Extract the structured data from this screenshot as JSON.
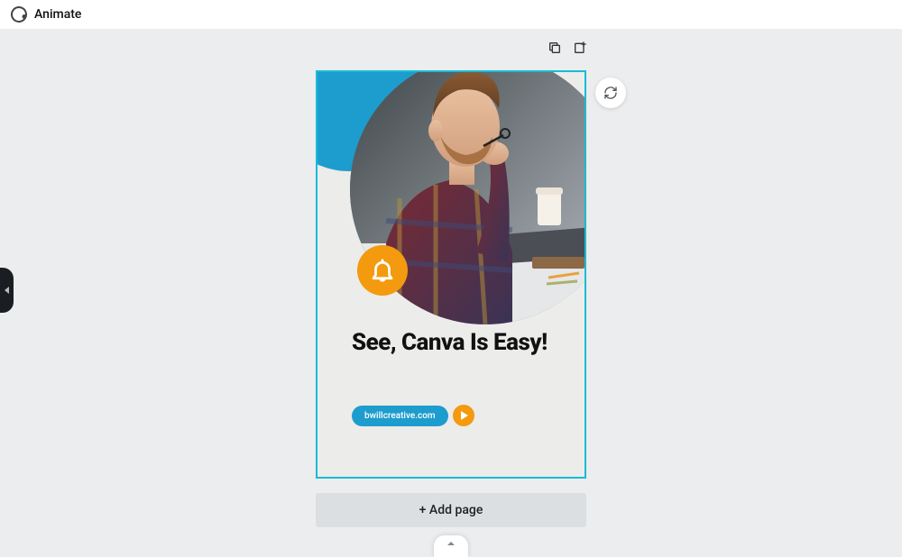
{
  "toolbar": {
    "animate_label": "Animate"
  },
  "design": {
    "headline": "See, Canva Is Easy!",
    "link_pill_text": "bwillcreative.com",
    "bell_icon": "bell-icon",
    "play_icon": "play-icon"
  },
  "controls": {
    "add_page_label": "+ Add page"
  },
  "icons": {
    "duplicate": "copy-icon",
    "share_new": "add-out-icon",
    "refresh": "refresh-icon"
  },
  "colors": {
    "accent_blue": "#1d9cce",
    "accent_orange": "#f39a0e",
    "selection": "#19bcd4"
  }
}
